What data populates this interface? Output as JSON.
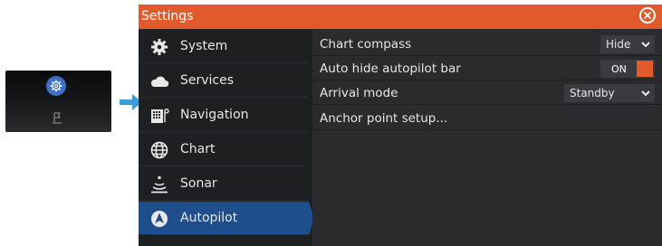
{
  "settings": {
    "title": "Settings",
    "accent_color": "#e05a2b",
    "selected_color": "#1e4e8c",
    "sidebar": [
      {
        "label": "System",
        "icon": "gear-icon"
      },
      {
        "label": "Services",
        "icon": "cloud-icon"
      },
      {
        "label": "Navigation",
        "icon": "navigation-icon"
      },
      {
        "label": "Chart",
        "icon": "globe-icon"
      },
      {
        "label": "Sonar",
        "icon": "sonar-icon"
      },
      {
        "label": "Autopilot",
        "icon": "autopilot-icon",
        "selected": true
      }
    ],
    "rows": [
      {
        "label": "Chart compass",
        "control": "dropdown",
        "value": "Hide"
      },
      {
        "label": "Auto hide autopilot bar",
        "control": "toggle",
        "value": "ON"
      },
      {
        "label": "Arrival mode",
        "control": "dropdown",
        "value": "Standby"
      },
      {
        "label": "Anchor point setup...",
        "control": "none"
      }
    ]
  },
  "thumbnail": {
    "icons": [
      "gear-icon",
      "flag-icon"
    ]
  }
}
